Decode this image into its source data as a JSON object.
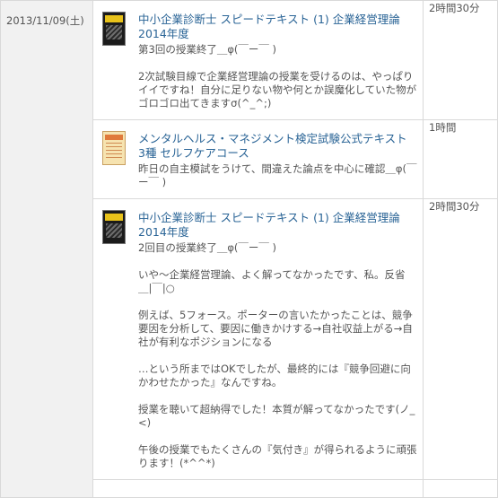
{
  "study_log": {
    "date": "2013/11/09(土)",
    "entries": [
      {
        "book_title": "中小企業診断士 スピードテキスト (1) 企業経営理論 2014年度",
        "summary": "第3回の授業終了＿φ(￣ー￣ )",
        "body": "2次試験目線で企業経営理論の授業を受けるのは、やっぱりイイですね！自分に足りない物や何とか誤魔化していた物がゴロゴロ出てきますσ(^_^;)",
        "duration": "2時間30分"
      },
      {
        "book_title": "メンタルヘルス・マネジメント検定試験公式テキスト 3種 セルフケアコース",
        "summary": "昨日の自主模試をうけて、間違えた論点を中心に確認＿φ(￣ー￣ )",
        "body": "",
        "duration": "1時間"
      },
      {
        "book_title": "中小企業診断士 スピードテキスト (1) 企業経営理論 2014年度",
        "summary": "2回目の授業終了＿φ(￣ー￣ )",
        "body": "いや〜企業経営理論、よく解ってなかったです、私。反省＿|￣|○\n\n例えば、5フォース。ポーターの言いたかったことは、競争要因を分析して、要因に働きかけする→自社収益上がる→自社が有利なポジションになる\n\n…という所まではOKでしたが、最終的には『競争回避に向かわせたかった』なんですね。\n\n授業を聴いて超納得でした！本質が解ってなかったです(ノ_<)\n\n午後の授業でもたくさんの『気付き』が得られるように頑張ります！(*^^*)",
        "duration": "2時間30分"
      }
    ]
  },
  "icons": {
    "book_cover_1": "speed-text-book-cover-icon",
    "book_cover_2": "mental-health-book-cover-icon",
    "book_cover_3": "speed-text-book-cover-icon"
  },
  "colors": {
    "link": "#2a6496",
    "date_column_bg": "#f1f1f1",
    "border": "#d9d9d9"
  }
}
